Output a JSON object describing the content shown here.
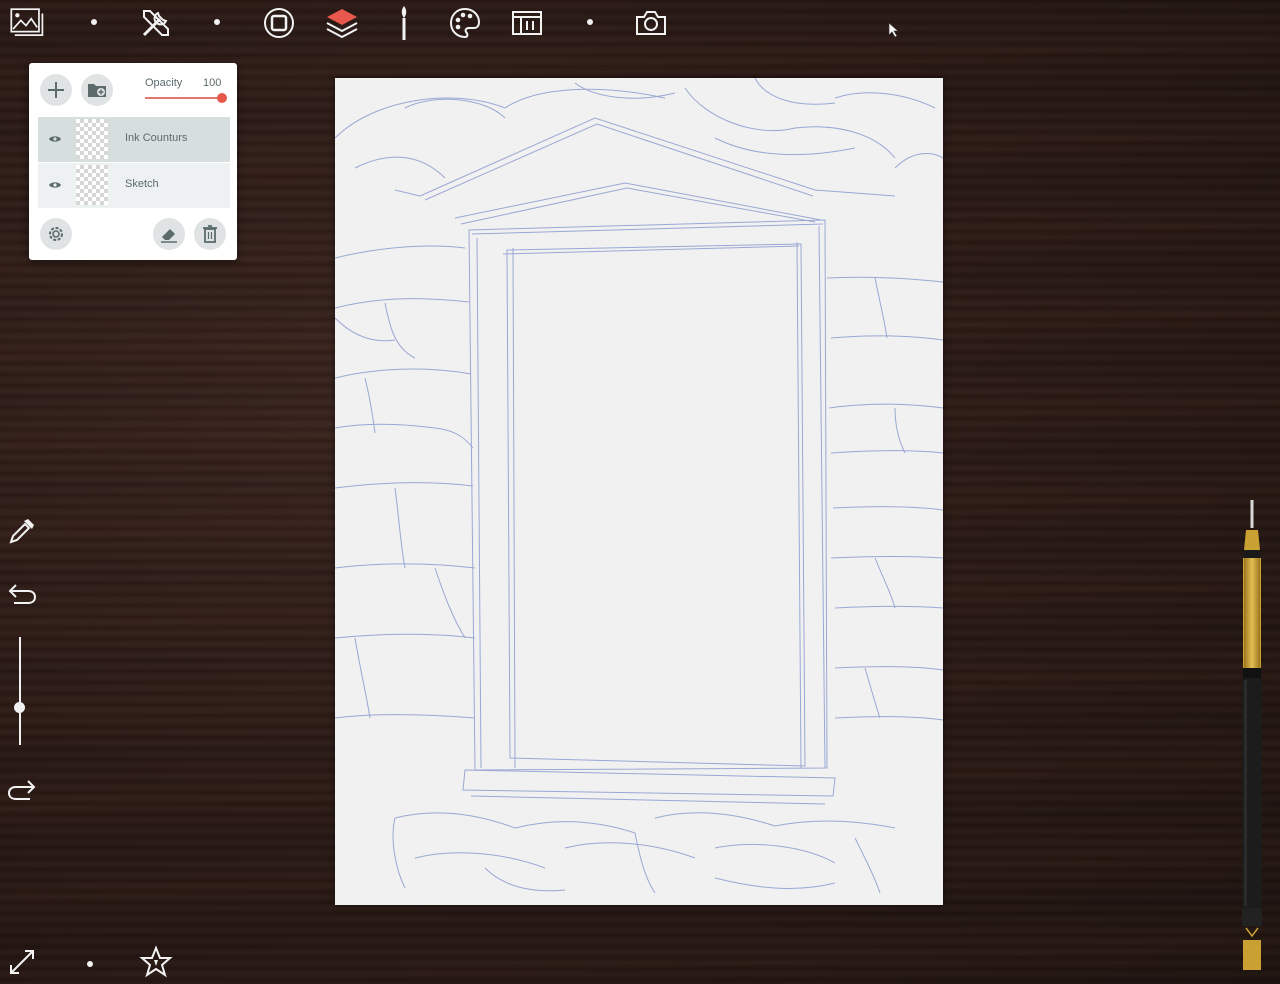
{
  "toolbar": {
    "items": [
      {
        "icon": "gallery-icon"
      },
      {
        "icon": "tools-icon"
      },
      {
        "icon": "canvas-frame-icon"
      },
      {
        "icon": "layers-icon"
      },
      {
        "icon": "brush-icon"
      },
      {
        "icon": "palette-icon"
      },
      {
        "icon": "reference-panel-icon"
      },
      {
        "icon": "camera-icon"
      }
    ]
  },
  "layers_panel": {
    "opacity_label": "Opacity",
    "opacity_value": "100",
    "opacity_fraction": 1.0,
    "layers": [
      {
        "name": "Ink Counturs",
        "visible": true,
        "selected": true
      },
      {
        "name": "Sketch",
        "visible": true,
        "selected": false
      }
    ]
  },
  "side_tools": {
    "brush_size_fraction": 0.4
  },
  "colors": {
    "accent": "#e8584c",
    "panel_bg": "#ffffff",
    "selected_row": "#d7dede",
    "sketch_line": "#8c9bd0",
    "pen_gold": "#c9a032"
  }
}
